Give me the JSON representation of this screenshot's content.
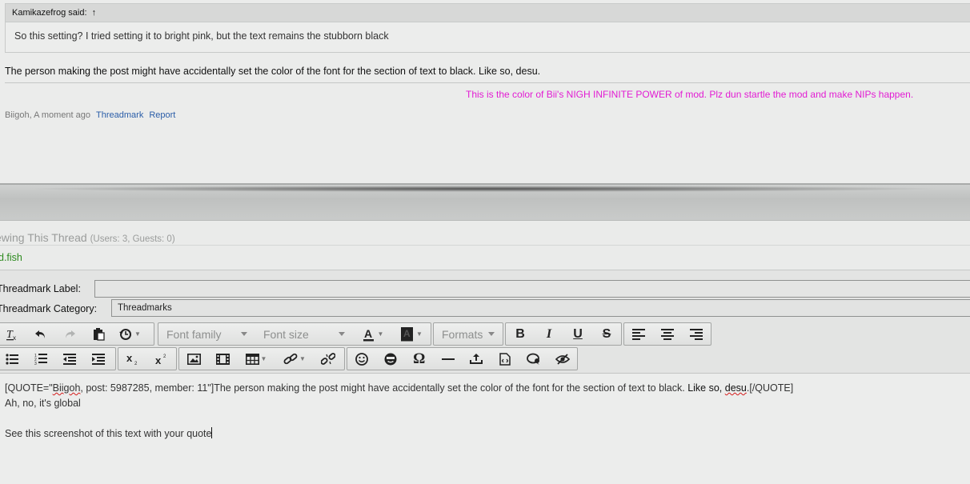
{
  "post": {
    "quote_author": "Kamikazefrog said:",
    "quote_arrow": "↑",
    "quote_text": "So this setting? I tried setting it to bright pink, but the text remains the stubborn black",
    "body_text": "The person making the post might have accidentally set the color of the font for the section of text to black. Like so, desu.",
    "signature": "This is the color of Bii's NIGH INFINITE POWER of mod. Plz dun startle the mod and make NIPs happen.",
    "signature_color": "#e21cd3",
    "author_time": "Biigoh, A moment ago",
    "threadmark_link": "Threadmark",
    "report_link": "Report"
  },
  "viewing": {
    "title": "ewing This Thread",
    "counts": "(Users: 3, Guests: 0)",
    "user": "d.fish",
    "user_color": "#2d8a1f"
  },
  "form": {
    "label_label": "Threadmark Label:",
    "label_value": "",
    "category_label": "Threadmark Category:",
    "category_value": "Threadmarks"
  },
  "toolbar": {
    "font_family": "Font family",
    "font_size": "Font size",
    "formats": "Formats"
  },
  "editor": {
    "line1_pre": "[QUOTE=\"",
    "line1_name": "Biigoh",
    "line1_mid": ", post: 5987285, member: 11\"]The person making the post might have accidentally set the color of the font for the section of text to black. ",
    "line1_like": "Like so, ",
    "line1_desu": "desu",
    "line1_end": ".[/QUOTE]",
    "line2": "Ah, no, it's global",
    "line3": "See this screenshot of this text with your quote"
  }
}
